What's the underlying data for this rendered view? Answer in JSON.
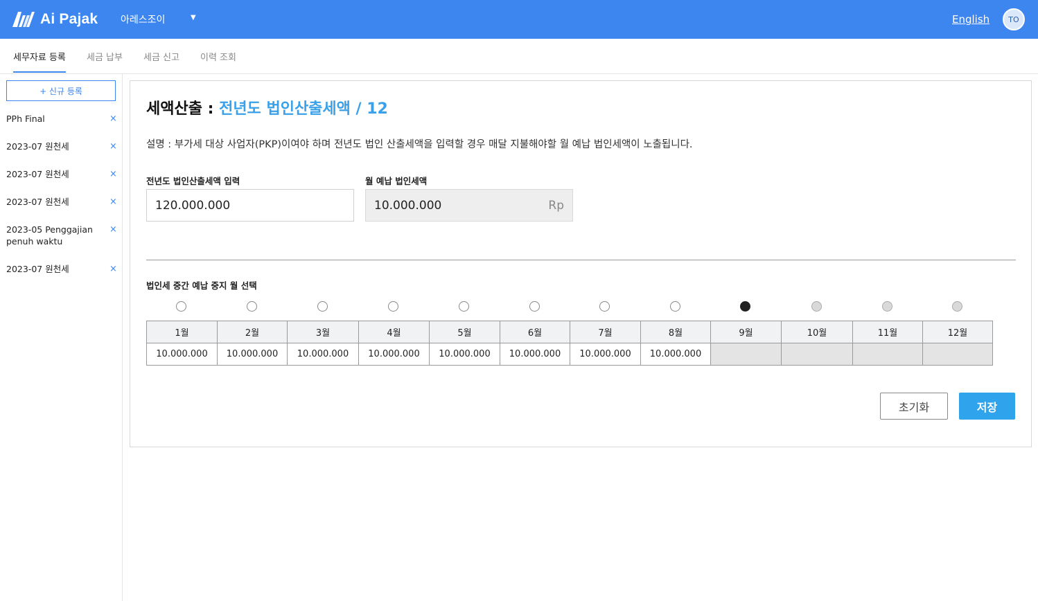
{
  "header": {
    "logo_text": "Ai Pajak",
    "company": "아레스조이",
    "language_link": "English",
    "avatar_initials": "TO",
    "brand_color": "#3d86f0"
  },
  "tabs": [
    {
      "label": "세무자료 등록",
      "active": true
    },
    {
      "label": "세금 납부",
      "active": false
    },
    {
      "label": "세금 신고",
      "active": false
    },
    {
      "label": "이력 조회",
      "active": false
    }
  ],
  "sidebar": {
    "new_button": "+ 신규 등록",
    "items": [
      {
        "label": "PPh Final"
      },
      {
        "label": "2023-07 원천세"
      },
      {
        "label": "2023-07 원천세"
      },
      {
        "label": "2023-07 원천세"
      },
      {
        "label": "2023-05 Penggajian penuh waktu"
      },
      {
        "label": "2023-07 원천세"
      }
    ],
    "close_icon": "×"
  },
  "main": {
    "title_prefix": "세액산출 : ",
    "title_highlight": "전년도 법인산출세액 / 12",
    "description": "설명 : 부가세 대상 사업자(PKP)이여야 하며 전년도 법인 산출세액을 입력할 경우 매달 지불해야할 월 예납 법인세액이 노출됩니다.",
    "input_label": "전년도 법인산출세액 입력",
    "input_value": "120.000.000",
    "monthly_label": "월 예납 법인세액",
    "monthly_value": "10.000.000",
    "monthly_unit": "Rp",
    "stop_month_label": "법인세 중간 예납 중지 월 선택",
    "selected_month_index": 8,
    "months": [
      {
        "label": "1월",
        "amount": "10.000.000"
      },
      {
        "label": "2월",
        "amount": "10.000.000"
      },
      {
        "label": "3월",
        "amount": "10.000.000"
      },
      {
        "label": "4월",
        "amount": "10.000.000"
      },
      {
        "label": "5월",
        "amount": "10.000.000"
      },
      {
        "label": "6월",
        "amount": "10.000.000"
      },
      {
        "label": "7월",
        "amount": "10.000.000"
      },
      {
        "label": "8월",
        "amount": "10.000.000"
      },
      {
        "label": "9월",
        "amount": ""
      },
      {
        "label": "10월",
        "amount": ""
      },
      {
        "label": "11월",
        "amount": ""
      },
      {
        "label": "12월",
        "amount": ""
      }
    ],
    "reset_button": "초기화",
    "save_button": "저장"
  }
}
